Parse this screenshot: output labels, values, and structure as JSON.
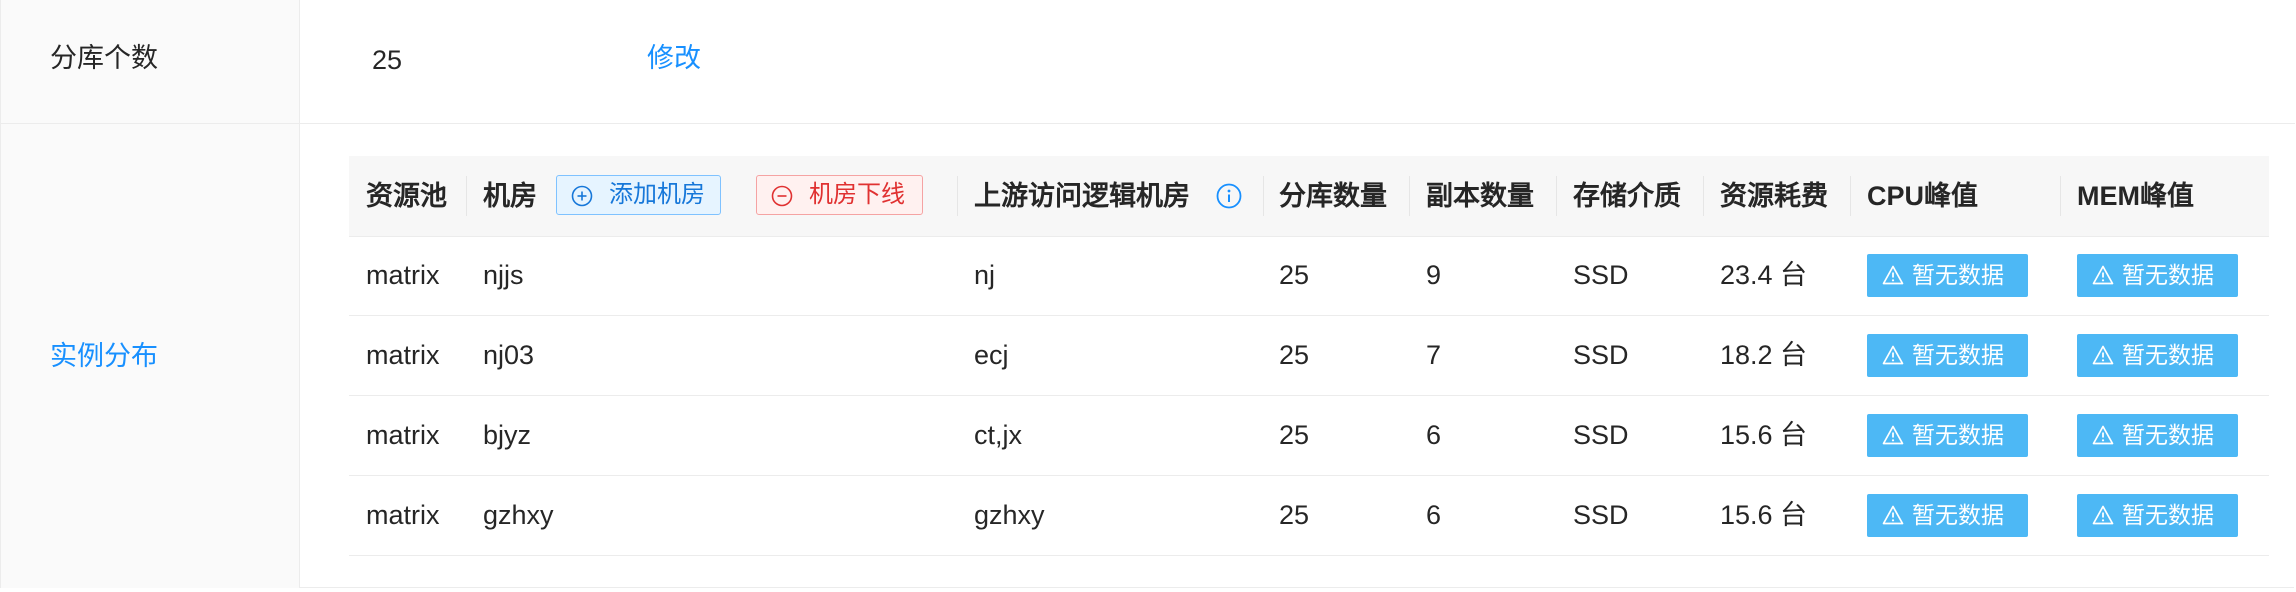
{
  "shard_count": {
    "label": "分库个数",
    "value": "25",
    "edit_label": "修改"
  },
  "instances": {
    "label": "实例分布"
  },
  "table": {
    "headers": {
      "pool": "资源池",
      "room": "机房",
      "add_room": "添加机房",
      "offline_room": "机房下线",
      "upstream": "上游访问逻辑机房",
      "shards": "分库数量",
      "replicas": "副本数量",
      "storage": "存储介质",
      "cost": "资源耗费",
      "cpu": "CPU峰值",
      "mem": "MEM峰值"
    },
    "rows": [
      {
        "pool": "matrix",
        "room": "njjs",
        "upstream": "nj",
        "shards": "25",
        "replicas": "9",
        "storage": "SSD",
        "cost": "23.4 台",
        "cpu": "暂无数据",
        "mem": "暂无数据"
      },
      {
        "pool": "matrix",
        "room": "nj03",
        "upstream": "ecj",
        "shards": "25",
        "replicas": "7",
        "storage": "SSD",
        "cost": "18.2 台",
        "cpu": "暂无数据",
        "mem": "暂无数据"
      },
      {
        "pool": "matrix",
        "room": "bjyz",
        "upstream": "ct,jx",
        "shards": "25",
        "replicas": "6",
        "storage": "SSD",
        "cost": "15.6 台",
        "cpu": "暂无数据",
        "mem": "暂无数据"
      },
      {
        "pool": "matrix",
        "room": "gzhxy",
        "upstream": "gzhxy",
        "shards": "25",
        "replicas": "6",
        "storage": "SSD",
        "cost": "15.6 台",
        "cpu": "暂无数据",
        "mem": "暂无数据"
      }
    ]
  },
  "colors": {
    "link": "#1890ff",
    "nodata_button": "#4db8f5",
    "danger": "#e03131"
  }
}
